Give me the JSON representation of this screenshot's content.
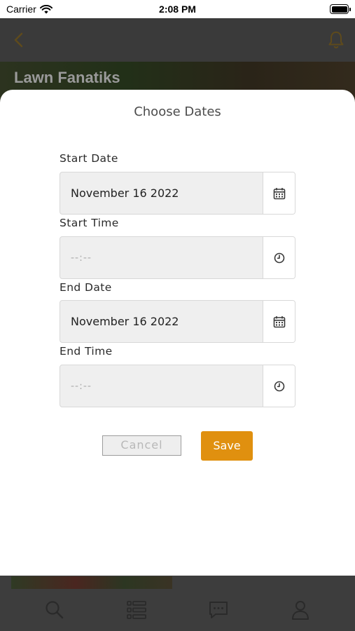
{
  "status_bar": {
    "carrier": "Carrier",
    "time": "2:08 PM"
  },
  "background": {
    "banner_title": "Lawn Fanatiks",
    "accent_color": "#e0900f",
    "icons": [
      "chevron-left-icon",
      "bell-icon",
      "search-icon",
      "list-icon",
      "chat-icon",
      "profile-icon"
    ]
  },
  "modal": {
    "title": "Choose Dates",
    "start_date": {
      "label": "Start Date",
      "value": "November 16 2022",
      "icon": "calendar-icon"
    },
    "start_time": {
      "label": "Start Time",
      "value": "--:--",
      "icon": "clock-icon"
    },
    "end_date": {
      "label": "End Date",
      "value": "November 16 2022",
      "icon": "calendar-icon"
    },
    "end_time": {
      "label": "End Time",
      "value": "--:--",
      "icon": "clock-icon"
    },
    "cancel_label": "Cancel",
    "save_label": "Save"
  }
}
